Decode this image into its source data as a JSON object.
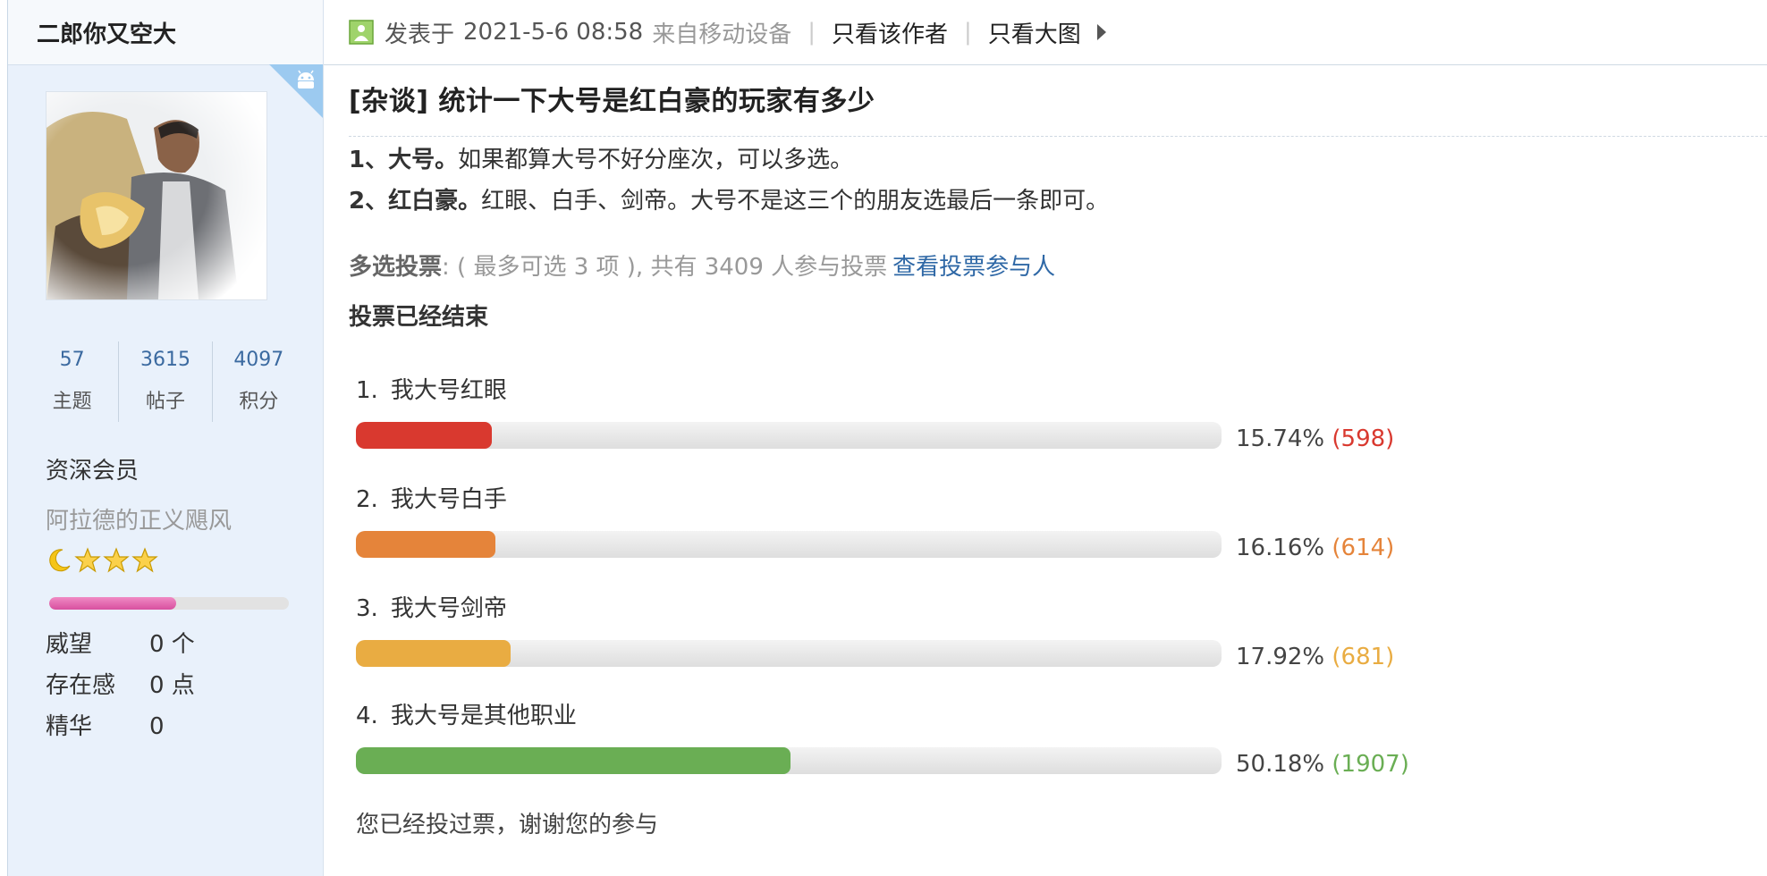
{
  "sidebar": {
    "author_name": "二郎你又空大",
    "stats": [
      {
        "value": "57",
        "label": "主题"
      },
      {
        "value": "3615",
        "label": "帖子"
      },
      {
        "value": "4097",
        "label": "积分"
      }
    ],
    "rank": "资深会员",
    "custom_title": "阿拉德的正义飓风",
    "level_progress": 0.53,
    "info": [
      {
        "key": "威望",
        "value": "0 个"
      },
      {
        "key": "存在感",
        "value": "0 点"
      },
      {
        "key": "精华",
        "value": "0"
      }
    ]
  },
  "post_header": {
    "posted_label": "发表于",
    "date": "2021-5-6 08:58",
    "source": "来自移动设备",
    "only_author": "只看该作者",
    "big_image": "只看大图"
  },
  "post": {
    "title": "[杂谈] 统计一下大号是红白豪的玩家有多少",
    "line1_bold": "1、大号。",
    "line1_text": "如果都算大号不好分座次，可以多选。",
    "line2_bold": "2、红白豪。",
    "line2_text": "红眼、白手、剑帝。大号不是这三个的朋友选最后一条即可。"
  },
  "poll": {
    "type_label": "多选投票",
    "meta_text": ": ( 最多可选 3 项 ), 共有 3409 人参与投票",
    "view_voters": "查看投票参与人",
    "ended": "投票已经结束",
    "voted_msg": "您已经投过票，谢谢您的参与",
    "options": [
      {
        "num": "1.",
        "label": "我大号红眼",
        "percent": "15.74%",
        "count": "(598)",
        "fraction": 0.1574,
        "color": "#d9392f"
      },
      {
        "num": "2.",
        "label": "我大号白手",
        "percent": "16.16%",
        "count": "(614)",
        "fraction": 0.1616,
        "color": "#e5843a"
      },
      {
        "num": "3.",
        "label": "我大号剑帝",
        "percent": "17.92%",
        "count": "(681)",
        "fraction": 0.1792,
        "color": "#e9ac42"
      },
      {
        "num": "4.",
        "label": "我大号是其他职业",
        "percent": "50.18%",
        "count": "(1907)",
        "fraction": 0.5018,
        "color": "#6aae54"
      }
    ]
  },
  "icons": {
    "mobile": "android-icon",
    "post": "image-icon",
    "stars": [
      "moon-icon",
      "star-icon",
      "star-icon",
      "star-icon"
    ]
  }
}
